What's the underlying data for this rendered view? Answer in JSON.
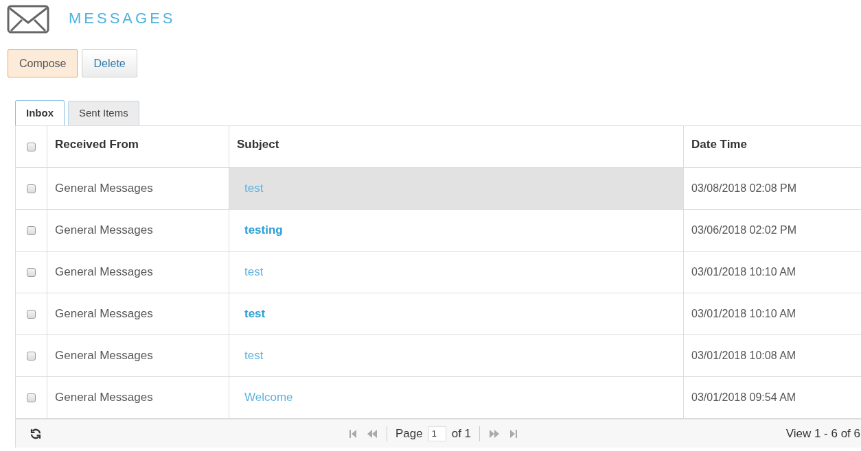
{
  "header": {
    "title": "MESSAGES"
  },
  "buttons": [
    {
      "label": "Compose",
      "kind": "primary"
    },
    {
      "label": "Delete",
      "kind": "default"
    }
  ],
  "tabs": [
    {
      "label": "Inbox",
      "selected": true
    },
    {
      "label": "Sent Items",
      "selected": false
    }
  ],
  "table": {
    "select_all": {
      "checked": false
    },
    "columns": [
      "Received From",
      "Subject",
      "Date Time"
    ],
    "rows": [
      {
        "checked": false,
        "from": "General Messages",
        "subject": "test",
        "unread": false,
        "highlighted": true,
        "date": "03/08/2018 02:08 PM"
      },
      {
        "checked": false,
        "from": "General Messages",
        "subject": "testing",
        "unread": true,
        "highlighted": false,
        "date": "03/06/2018 02:02 PM"
      },
      {
        "checked": false,
        "from": "General Messages",
        "subject": "test",
        "unread": false,
        "highlighted": false,
        "date": "03/01/2018 10:10 AM"
      },
      {
        "checked": false,
        "from": "General Messages",
        "subject": "test",
        "unread": true,
        "highlighted": false,
        "date": "03/01/2018 10:10 AM"
      },
      {
        "checked": false,
        "from": "General Messages",
        "subject": "test",
        "unread": false,
        "highlighted": false,
        "date": "03/01/2018 10:08 AM"
      },
      {
        "checked": false,
        "from": "General Messages",
        "subject": "Welcome",
        "unread": false,
        "highlighted": false,
        "date": "03/01/2018 09:54 AM"
      }
    ]
  },
  "pager": {
    "page_label": "Page",
    "page": "1",
    "of_label": "of 1",
    "view": "View 1 - 6 of 6"
  }
}
